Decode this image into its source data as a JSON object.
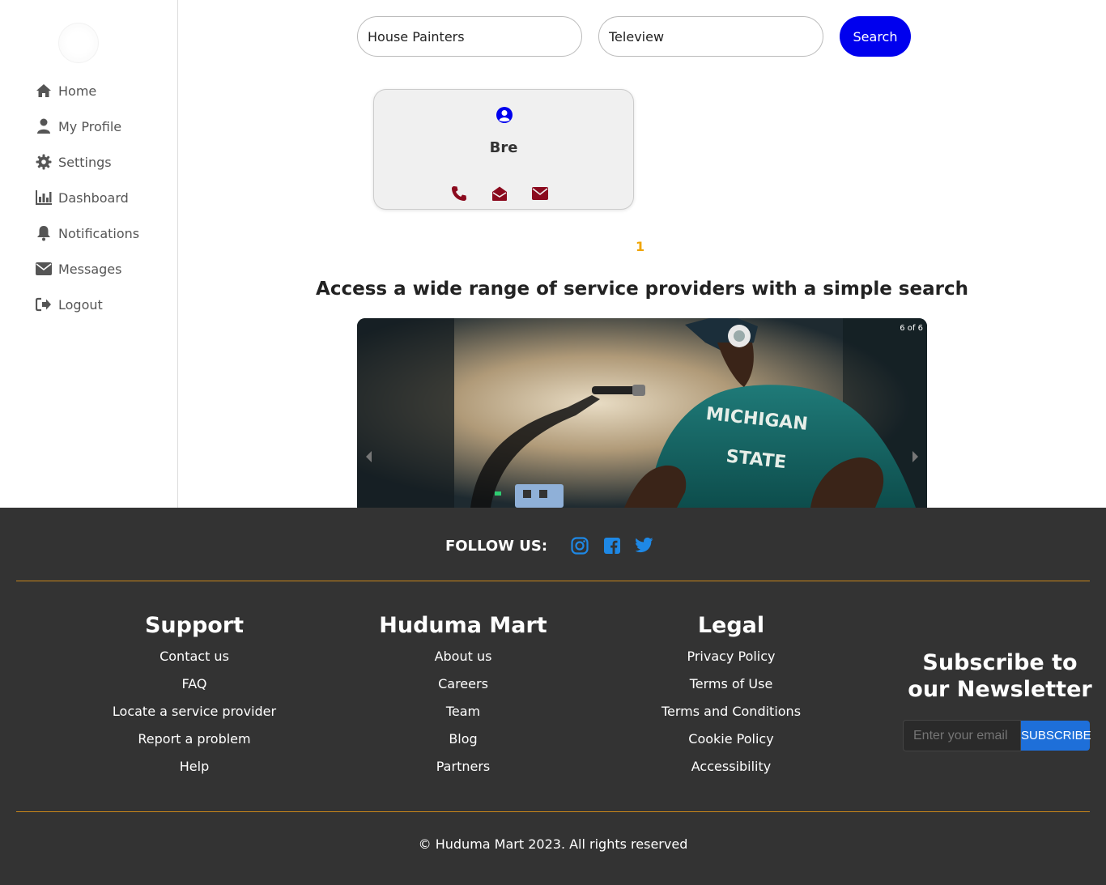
{
  "sidebar": {
    "items": [
      {
        "label": "Home",
        "icon": "home-icon"
      },
      {
        "label": "My Profile",
        "icon": "user-icon"
      },
      {
        "label": "Settings",
        "icon": "gear-icon"
      },
      {
        "label": "Dashboard",
        "icon": "chart-icon"
      },
      {
        "label": "Notifications",
        "icon": "bell-icon"
      },
      {
        "label": "Messages",
        "icon": "envelope-icon"
      },
      {
        "label": "Logout",
        "icon": "logout-icon"
      }
    ]
  },
  "search": {
    "service_value": "House Painters",
    "location_value": "Teleview",
    "button_label": "Search"
  },
  "results": [
    {
      "name": "Bre",
      "actions": [
        "phone-icon",
        "envelope-open-icon",
        "envelope-icon"
      ]
    }
  ],
  "pagination": {
    "current": "1"
  },
  "tagline": "Access a wide range of service providers with a simple search",
  "carousel": {
    "counter": "6 of 6"
  },
  "footer": {
    "follow_label": "FOLLOW US:",
    "social": [
      "instagram-icon",
      "facebook-icon",
      "twitter-icon"
    ],
    "columns": [
      {
        "title": "Support",
        "links": [
          "Contact us",
          "FAQ",
          "Locate a service provider",
          "Report a problem",
          "Help"
        ]
      },
      {
        "title": "Huduma Mart",
        "links": [
          "About us",
          "Careers",
          "Team",
          "Blog",
          "Partners"
        ]
      },
      {
        "title": "Legal",
        "links": [
          "Privacy Policy",
          "Terms of Use",
          "Terms and Conditions",
          "Cookie Policy",
          "Accessibility"
        ]
      }
    ],
    "newsletter": {
      "title": "Subscribe to our Newsletter",
      "placeholder": "Enter your email",
      "button_label": "SUBSCRIBE"
    },
    "copyright": "© Huduma Mart 2023. All rights reserved"
  },
  "colors": {
    "primary_blue": "#0000ee",
    "accent_orange": "#f0a500",
    "icon_maroon": "#8b0a1e",
    "footer_bg": "#333333",
    "social_blue": "#1e88e5"
  }
}
